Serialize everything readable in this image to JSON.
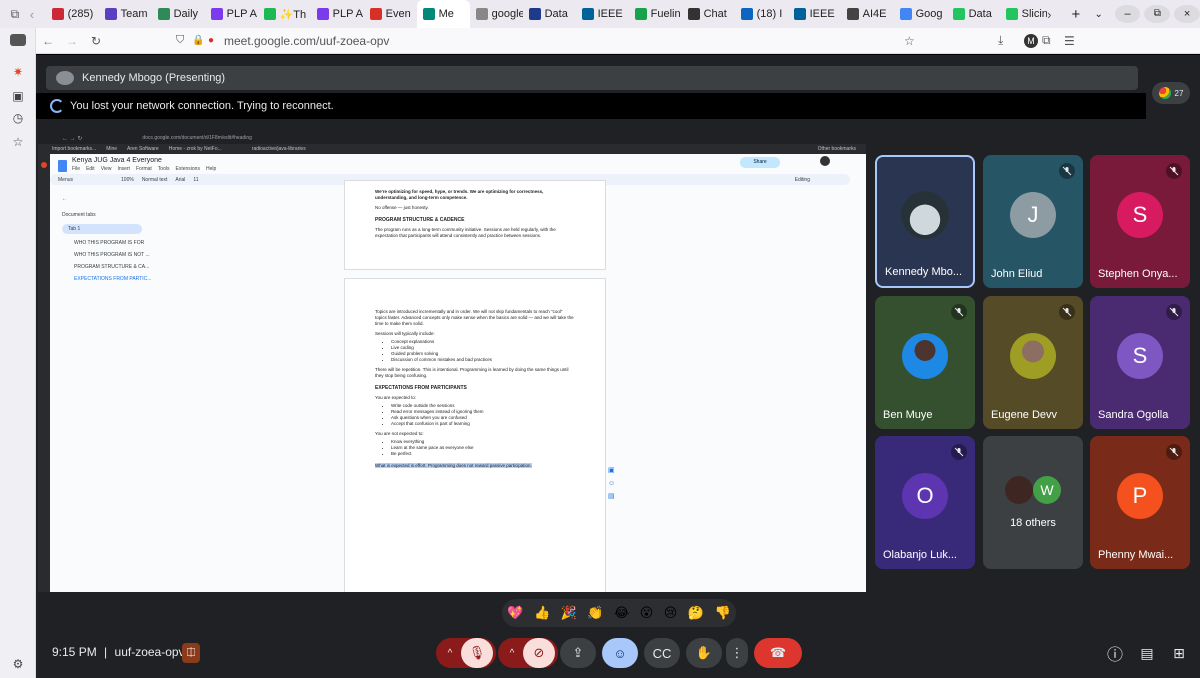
{
  "browser": {
    "tabs": [
      {
        "label": "(285)",
        "color": "#cc2936"
      },
      {
        "label": "Team",
        "color": "#5a3fc0"
      },
      {
        "label": "Daily",
        "color": "#2e8b57"
      },
      {
        "label": "PLP A",
        "color": "#7c3aed"
      },
      {
        "label": "✨Th",
        "color": "#1db954"
      },
      {
        "label": "PLP A",
        "color": "#7c3aed"
      },
      {
        "label": "Even",
        "color": "#d93025"
      },
      {
        "label": "Me",
        "color": "#00897b",
        "active": true
      },
      {
        "label": "google.c",
        "color": "#888888"
      },
      {
        "label": "Data",
        "color": "#1e3a8a"
      },
      {
        "label": "IEEE",
        "color": "#00629b"
      },
      {
        "label": "Fuelin",
        "color": "#16a34a"
      },
      {
        "label": "Chat",
        "color": "#333333"
      },
      {
        "label": "(18) I",
        "color": "#0a66c2"
      },
      {
        "label": "IEEE",
        "color": "#00629b"
      },
      {
        "label": "AI4E",
        "color": "#444444"
      },
      {
        "label": "Goog",
        "color": "#4285f4"
      },
      {
        "label": "Data",
        "color": "#22c55e"
      },
      {
        "label": "Slicin",
        "color": "#22c55e"
      }
    ],
    "url": "meet.google.com/uuf-zoea-opv"
  },
  "meet": {
    "presenter_label": "Kennedy Mbogo (Presenting)",
    "reconnect_msg": "You lost your network connection. Trying to reconnect.",
    "participant_count": "27",
    "time": "9:15 PM",
    "separator": "|",
    "meeting_code": "uuf-zoea-opv",
    "reactions": [
      "💖",
      "👍",
      "🎉",
      "👏",
      "😂",
      "😮",
      "😢",
      "🤔",
      "👎"
    ]
  },
  "participants": [
    {
      "name": "Kennedy Mbo...",
      "kind": "photo",
      "bg": "#2a3552",
      "muted": false
    },
    {
      "name": "John Eliud",
      "kind": "initial",
      "initial": "J",
      "bg": "#265566",
      "avatar_bg": "#8d9ba3",
      "muted": true
    },
    {
      "name": "Stephen Onya...",
      "kind": "initial",
      "initial": "S",
      "bg": "#7a1a3a",
      "avatar_bg": "#d81b60",
      "muted": true
    },
    {
      "name": "Ben Muye",
      "kind": "photo",
      "bg": "#35502e",
      "muted": true
    },
    {
      "name": "Eugene Devv",
      "kind": "photo",
      "bg": "#564b27",
      "muted": true
    },
    {
      "name": "Sandra Ogolla",
      "kind": "initial",
      "initial": "S",
      "bg": "#4a2a70",
      "avatar_bg": "#7e57c2",
      "muted": true
    },
    {
      "name": "Olabanjo Luk...",
      "kind": "initial",
      "initial": "O",
      "bg": "#382a78",
      "avatar_bg": "#5e35b1",
      "muted": true
    },
    {
      "name": "18 others",
      "kind": "others",
      "bg": "#3c4043",
      "initial": "W",
      "muted": false
    },
    {
      "name": "Phenny Mwai...",
      "kind": "initial",
      "initial": "P",
      "bg": "#7a2a18",
      "avatar_bg": "#f4511e",
      "muted": true
    }
  ],
  "doc": {
    "title": "Kenya JUG Java 4 Everyone",
    "menu": [
      "File",
      "Edit",
      "View",
      "Insert",
      "Format",
      "Tools",
      "Extensions",
      "Help"
    ],
    "toolbar_menus": "Menus",
    "zoom": "100%",
    "style": "Normal text",
    "font": "Arial",
    "size": "11",
    "editing": "Editing",
    "share": "Share",
    "doc_url": "docs.google.com/document/d/1F8m/edit#heading",
    "bookmarks": [
      "Import bookmarks...",
      "Mine",
      "Aren Software",
      "Home - zrok by NetFo...",
      "radioactive/java-libraries"
    ],
    "other_bookmarks": "Other bookmarks",
    "tabs_title": "Document tabs",
    "tab1": "Tab 1",
    "outline": [
      "WHO THIS PROGRAM IS FOR",
      "WHO THIS PROGRAM IS NOT ...",
      "PROGRAM STRUCTURE & CA...",
      "EXPECTATIONS FROM PARTIC..."
    ],
    "p1_top": "We're optimizing for speed, hype, or trends. We are optimizing for correctness, understanding, and long-term competence.",
    "p1_line2": "No offense — just honesty.",
    "h1": "PROGRAM STRUCTURE & CADENCE",
    "p1_body": "The program runs as a long-term community initiative. Sessions are held regularly, with the expectation that participants will attend consistently and practice between sessions.",
    "p2_intro": "Topics are introduced incrementally and in order. We will not skip fundamentals to reach \"cool\" topics faster. Advanced concepts only make sense when the basics are solid — and we will take the time to make them solid.",
    "p2_sessions": "Sessions will typically include:",
    "list1": [
      "Concept explanations",
      "Live coding",
      "Guided problem solving",
      "Discussion of common mistakes and bad practices"
    ],
    "p2_rep": "There will be repetition. This is intentional. Programming is learned by doing the same things until they stop being confusing.",
    "h2": "EXPECTATIONS FROM PARTICIPANTS",
    "p3_expected": "You are expected to:",
    "list2": [
      "Write code outside the sessions",
      "Read error messages instead of ignoring them",
      "Ask questions when you are confused",
      "Accept that confusion is part of learning"
    ],
    "p3_not": "You are not expected to:",
    "list3": [
      "Know everything",
      "Learn at the same pace as everyone else",
      "Be perfect"
    ],
    "p3_final": "What is expected is effort. Programming does not reward passive participation."
  }
}
